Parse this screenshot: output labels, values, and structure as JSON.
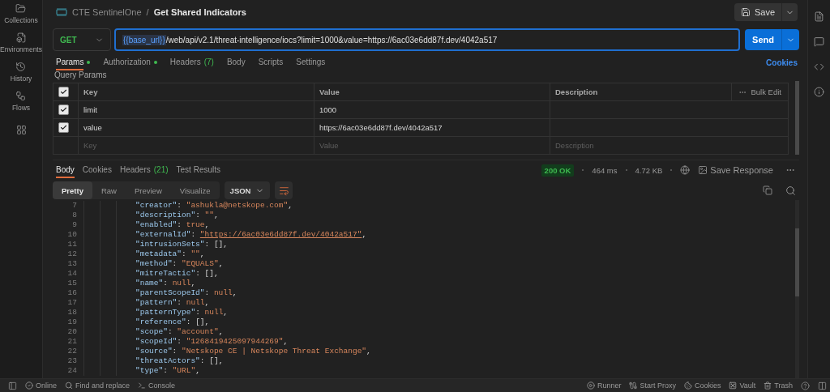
{
  "sidebar": {
    "items": [
      {
        "label": "Collections"
      },
      {
        "label": "Environments"
      },
      {
        "label": "History"
      },
      {
        "label": "Flows"
      }
    ]
  },
  "breadcrumb": {
    "collection": "CTE SentinelOne",
    "separator": "/",
    "request": "Get Shared Indicators"
  },
  "save_button": "Save",
  "request": {
    "method": "GET",
    "url_variable": "{{base_url}}",
    "url_path": " /web/api/v2.1/threat-intelligence/iocs?limit=1000&value=https://6ac03e6dd87f.dev/4042a517",
    "send": "Send"
  },
  "request_tabs": [
    {
      "label": "Params",
      "dot": true,
      "selected": true
    },
    {
      "label": "Authorization",
      "dot": true,
      "selected": false
    },
    {
      "label": "Headers",
      "dot": false,
      "count": "(7)",
      "selected": false
    },
    {
      "label": "Body",
      "dot": false,
      "selected": false
    },
    {
      "label": "Scripts",
      "dot": false,
      "selected": false
    },
    {
      "label": "Settings",
      "dot": false,
      "selected": false
    }
  ],
  "cookies_link": "Cookies",
  "query_params": {
    "title": "Query Params",
    "all_checked": true,
    "columns": [
      "Key",
      "Value",
      "Description"
    ],
    "bulk_edit": "Bulk Edit",
    "rows": [
      {
        "key": "limit",
        "value": "1000",
        "checked": true
      },
      {
        "key": "value",
        "value": "https://6ac03e6dd87f.dev/4042a517",
        "checked": true
      }
    ],
    "new_row": {
      "key": {
        "placeholder": "Key"
      },
      "value": {
        "placeholder": "Value"
      },
      "description": {
        "placeholder": "Description"
      }
    }
  },
  "response_tabs": [
    {
      "label": "Body",
      "selected": true
    },
    {
      "label": "Cookies",
      "selected": false
    },
    {
      "label": "Headers",
      "count": "(21)",
      "selected": false
    },
    {
      "label": "Test Results",
      "selected": false
    }
  ],
  "response_meta": {
    "status": "200 OK",
    "time": "464 ms",
    "size": "4.72 KB",
    "save": "Save Response"
  },
  "view_modes": [
    {
      "label": "Pretty",
      "selected": true
    },
    {
      "label": "Raw",
      "selected": false
    },
    {
      "label": "Preview",
      "selected": false
    },
    {
      "label": "Visualize",
      "selected": false
    }
  ],
  "format": "JSON",
  "code_lines": [
    {
      "num": "7",
      "key": "\"creator\"",
      "colon": ":",
      "value": "\"ashukla@netskope.com\"",
      "comma": ",",
      "kind": "string"
    },
    {
      "num": "8",
      "key": "\"description\"",
      "colon": ":",
      "value": "\"\"",
      "comma": ",",
      "kind": "string"
    },
    {
      "num": "9",
      "key": "\"enabled\"",
      "colon": ":",
      "value": "true",
      "comma": ",",
      "kind": "keyword"
    },
    {
      "num": "10",
      "key": "\"externalId\"",
      "colon": ":",
      "value": "\"https://6ac03e6dd87f.dev/4042a517\"",
      "comma": ",",
      "kind": "link"
    },
    {
      "num": "11",
      "key": "\"intrusionSets\"",
      "colon": ":",
      "value": "[]",
      "comma": ",",
      "kind": "plain"
    },
    {
      "num": "12",
      "key": "\"metadata\"",
      "colon": ":",
      "value": "\"\"",
      "comma": ",",
      "kind": "string"
    },
    {
      "num": "13",
      "key": "\"method\"",
      "colon": ":",
      "value": "\"EQUALS\"",
      "comma": ",",
      "kind": "string"
    },
    {
      "num": "14",
      "key": "\"mitreTactic\"",
      "colon": ":",
      "value": "[]",
      "comma": ",",
      "kind": "plain"
    },
    {
      "num": "15",
      "key": "\"name\"",
      "colon": ":",
      "value": "null",
      "comma": ",",
      "kind": "keyword"
    },
    {
      "num": "16",
      "key": "\"parentScopeId\"",
      "colon": ":",
      "value": "null",
      "comma": ",",
      "kind": "keyword"
    },
    {
      "num": "17",
      "key": "\"pattern\"",
      "colon": ":",
      "value": "null",
      "comma": ",",
      "kind": "keyword"
    },
    {
      "num": "18",
      "key": "\"patternType\"",
      "colon": ":",
      "value": "null",
      "comma": ",",
      "kind": "keyword"
    },
    {
      "num": "19",
      "key": "\"reference\"",
      "colon": ":",
      "value": "[]",
      "comma": ",",
      "kind": "plain"
    },
    {
      "num": "20",
      "key": "\"scope\"",
      "colon": ":",
      "value": "\"account\"",
      "comma": ",",
      "kind": "string"
    },
    {
      "num": "21",
      "key": "\"scopeId\"",
      "colon": ":",
      "value": "\"1268419425097944269\"",
      "comma": ",",
      "kind": "string"
    },
    {
      "num": "22",
      "key": "\"source\"",
      "colon": ":",
      "value": "\"Netskope CE | Netskope Threat Exchange\"",
      "comma": ",",
      "kind": "string"
    },
    {
      "num": "23",
      "key": "\"threatActors\"",
      "colon": ":",
      "value": "[]",
      "comma": ",",
      "kind": "plain"
    },
    {
      "num": "24",
      "key": "\"type\"",
      "colon": ":",
      "value": "\"URL\"",
      "comma": ",",
      "kind": "string"
    }
  ],
  "status_bar": {
    "left": [
      {
        "label": "Online"
      },
      {
        "label": "Find and replace"
      },
      {
        "label": "Console"
      }
    ],
    "right": [
      {
        "label": "Runner"
      },
      {
        "label": "Start Proxy"
      },
      {
        "label": "Cookies"
      },
      {
        "label": "Vault"
      },
      {
        "label": "Trash"
      }
    ]
  }
}
